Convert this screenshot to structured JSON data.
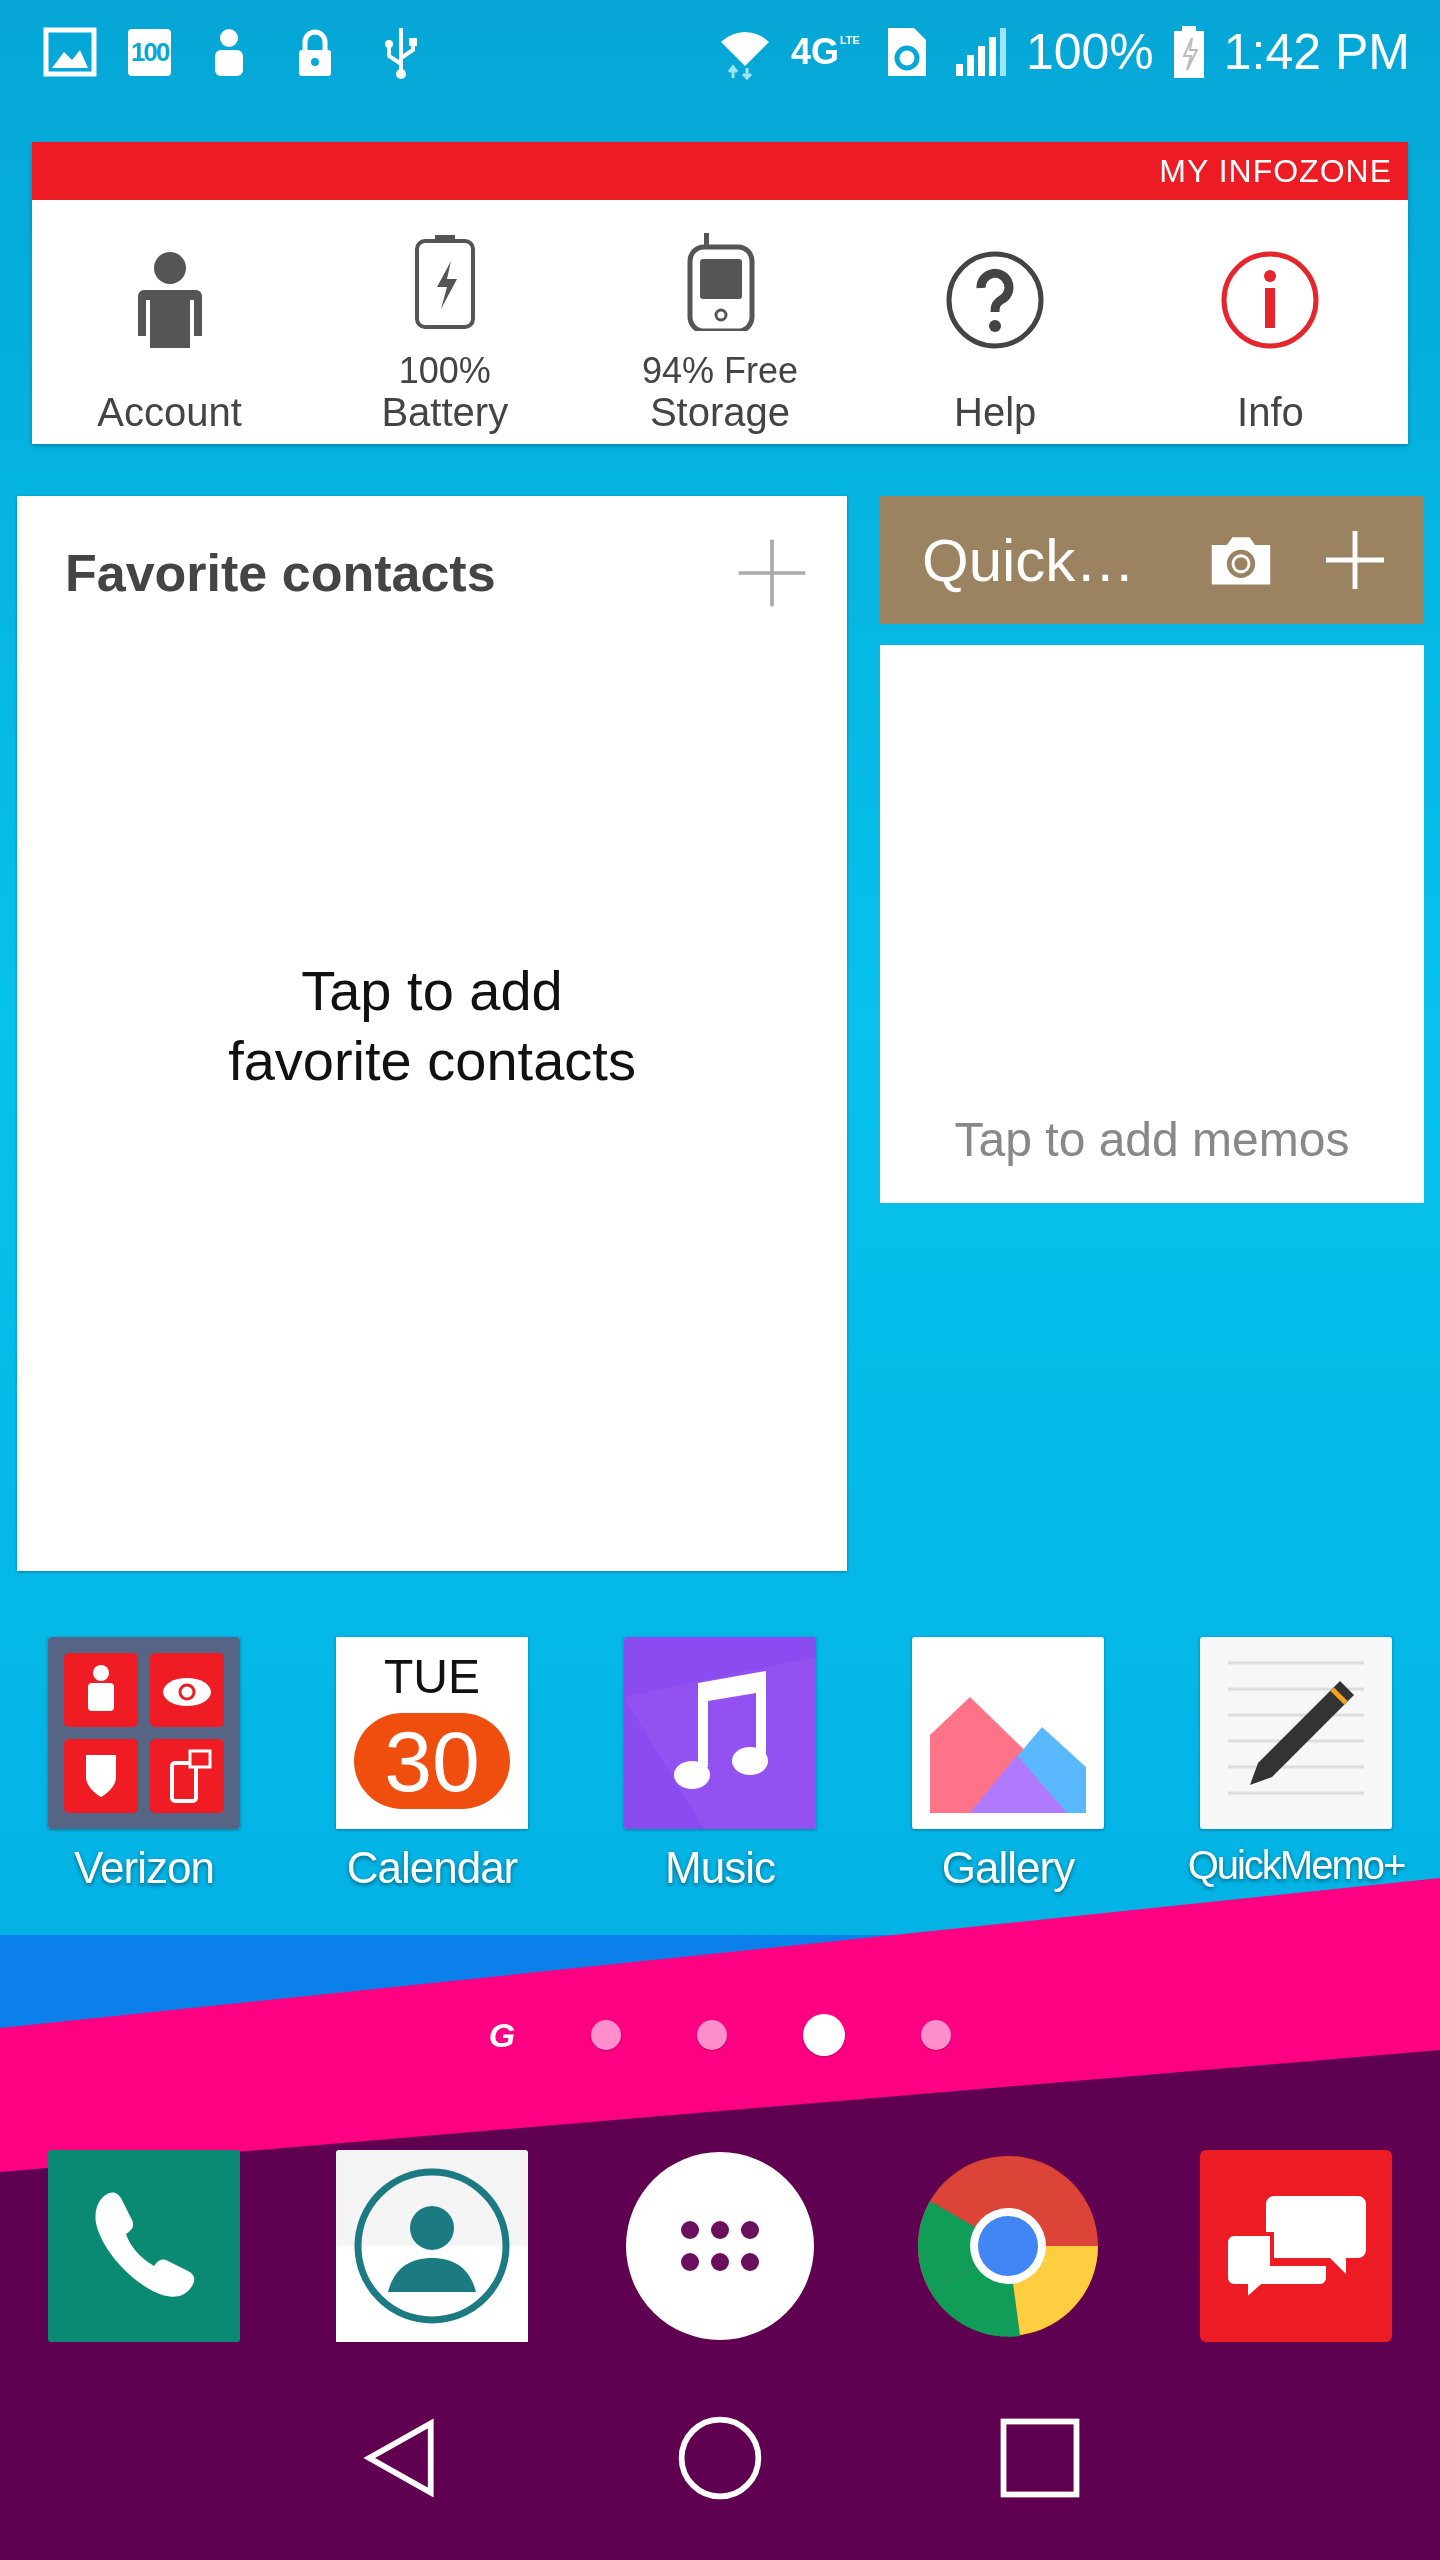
{
  "status_bar": {
    "saver_badge": "100",
    "network": "4G",
    "network_sub": "LTE",
    "battery": "100%",
    "time": "1:42 PM"
  },
  "infozone": {
    "title": "MY INFOZONE",
    "items": [
      {
        "kind": "account",
        "lines": [
          "Account"
        ]
      },
      {
        "kind": "battery",
        "lines": [
          "100%",
          "Battery"
        ]
      },
      {
        "kind": "storage",
        "lines": [
          "94% Free",
          "Storage"
        ]
      },
      {
        "kind": "help",
        "lines": [
          "Help"
        ]
      },
      {
        "kind": "info",
        "lines": [
          "Info"
        ]
      }
    ]
  },
  "favorites": {
    "title": "Favorite contacts",
    "empty_text": "Tap to add\nfavorite contacts"
  },
  "quick_memo": {
    "title": "Quick…",
    "empty_text": "Tap to add memos"
  },
  "apps": [
    {
      "kind": "verizon",
      "label": "Verizon"
    },
    {
      "kind": "calendar",
      "label": "Calendar",
      "day": "TUE",
      "date": "30"
    },
    {
      "kind": "music",
      "label": "Music"
    },
    {
      "kind": "gallery",
      "label": "Gallery"
    },
    {
      "kind": "quickmemo",
      "label": "QuickMemo+"
    }
  ],
  "page_indicator": {
    "home_label": "G",
    "pages": [
      {
        "selected": false
      },
      {
        "selected": false
      },
      {
        "selected": true
      },
      {
        "selected": false
      }
    ]
  },
  "dock": [
    {
      "kind": "phone"
    },
    {
      "kind": "contacts"
    },
    {
      "kind": "apps"
    },
    {
      "kind": "browser"
    },
    {
      "kind": "messages"
    }
  ]
}
